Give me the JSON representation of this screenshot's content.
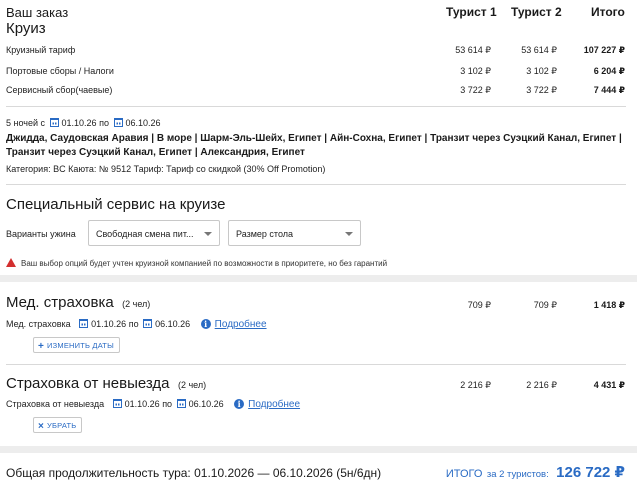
{
  "header": {
    "order_label": "Ваш заказ",
    "product_title": "Круиз",
    "col_tourist1": "Турист 1",
    "col_tourist2": "Турист 2",
    "col_total": "Итого"
  },
  "price_rows": [
    {
      "label": "Круизный тариф",
      "t1": "53 614 ₽",
      "t2": "53 614 ₽",
      "total": "107 227 ₽"
    },
    {
      "label": "Портовые сборы / Налоги",
      "t1": "3 102 ₽",
      "t2": "3 102 ₽",
      "total": "6 204 ₽"
    },
    {
      "label": "Сервисный сбор(чаевые)",
      "t1": "3 722 ₽",
      "t2": "3 722 ₽",
      "total": "7 444 ₽"
    }
  ],
  "cruise": {
    "nights": "5 ночей с",
    "date_from": "01.10.26",
    "by": "по",
    "date_to": "06.10.26",
    "route": "Джидда, Саудовская Аравия | В море | Шарм-Эль-Шейх, Египет | Айн-Сохна, Египет | Транзит через Суэцкий Канал, Египет | Транзит через Суэцкий Канал, Египет | Александрия, Египет",
    "details": "Категория: BC   Каюта: № 9512   Тариф: Тариф со скидкой (30% Off Promotion)"
  },
  "special_service": {
    "title": "Специальный сервис на круизе",
    "dinner_label": "Варианты ужина",
    "dinner_value": "Свободная смена пит...",
    "table_value": "Размер стола",
    "warning": "Ваш выбор опций будет учтен круизной компанией по возможности в приоритете, но без гарантий"
  },
  "medical": {
    "title": "Мед. страховка",
    "count": "(2 чел)",
    "t1": "709 ₽",
    "t2": "709 ₽",
    "total": "1 418 ₽",
    "row_label": "Мед. страховка",
    "date_from": "01.10.26",
    "by": "по",
    "date_to": "06.10.26",
    "more": "Подробнее",
    "button": "ИЗМЕНИТЬ ДАТЫ"
  },
  "cancel": {
    "title": "Страховка от невыезда",
    "count": "(2 чел)",
    "t1": "2 216 ₽",
    "t2": "2 216 ₽",
    "total": "4 431 ₽",
    "row_label": "Страховка от невыезда",
    "date_from": "01.10.26",
    "by": "по",
    "date_to": "06.10.26",
    "more": "Подробнее",
    "button": "УБРАТЬ"
  },
  "footer": {
    "duration": "Общая продолжительность тура: 01.10.2026 — 06.10.2026 (5н/6дн)",
    "total_label": "ИТОГО",
    "total_for": "за 2 туристов:",
    "total_value": "126 722 ₽"
  },
  "colors": {
    "accent": "#2a6bc4",
    "warning": "#d32f2f"
  }
}
